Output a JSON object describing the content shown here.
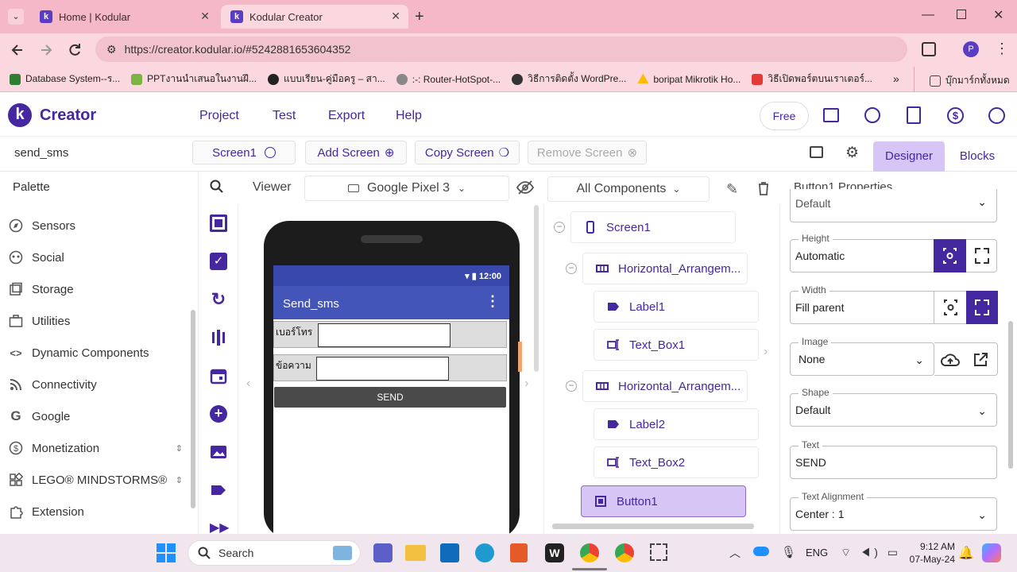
{
  "browser": {
    "tabs": [
      {
        "title": "Home | Kodular",
        "favicon": "kodular-logo"
      },
      {
        "title": "Kodular Creator",
        "favicon": "kodular-logo"
      }
    ],
    "url": "https://creator.kodular.io/#5242881653604352",
    "profile_initial": "P",
    "bookmarks": [
      {
        "label": "Database System--ร...",
        "icon": "3b-icon",
        "color": "#2e7d32"
      },
      {
        "label": "PPTงานนำเสนอในงานฝึ...",
        "icon": "slides-icon",
        "color": "#7cb342"
      },
      {
        "label": "แบบเรียน-คู่มือครู – สา...",
        "icon": "globe-icon",
        "color": "#222222"
      },
      {
        "label": ":-: Router-HotSpot-...",
        "icon": "moon-icon",
        "color": "#555555"
      },
      {
        "label": "วิธีการติดตั้ง WordPre...",
        "icon": "wp-icon",
        "color": "#333333"
      },
      {
        "label": "boripat Mikrotik Ho...",
        "icon": "drive-icon",
        "color": "#fbbc04"
      },
      {
        "label": "วิธีเปิดพอร์ตบนเราเตอร์...",
        "icon": "youtube-icon",
        "color": "#e53935"
      }
    ],
    "bookmarks_folder": "บุ๊กมาร์กทั้งหมด"
  },
  "app": {
    "brand": "Creator",
    "logo_letter": "k",
    "nav": [
      "Project",
      "Test",
      "Export",
      "Help"
    ],
    "plan_badge": "Free",
    "project_name": "send_sms",
    "screen_select": "Screen1",
    "add_screen": "Add Screen",
    "copy_screen": "Copy Screen",
    "remove_screen": "Remove Screen",
    "designer_tab": "Designer",
    "blocks_tab": "Blocks",
    "accent": "#4527a0"
  },
  "palette": {
    "title": "Palette",
    "items": [
      {
        "label": "Sensors",
        "icon": "compass-icon"
      },
      {
        "label": "Social",
        "icon": "social-icon"
      },
      {
        "label": "Storage",
        "icon": "storage-icon"
      },
      {
        "label": "Utilities",
        "icon": "briefcase-icon"
      },
      {
        "label": "Dynamic Components",
        "icon": "code-icon"
      },
      {
        "label": "Connectivity",
        "icon": "rss-icon"
      },
      {
        "label": "Google",
        "icon": "google-icon"
      },
      {
        "label": "Monetization",
        "icon": "dollar-icon"
      },
      {
        "label": "LEGO® MINDSTORMS®",
        "icon": "lego-icon"
      },
      {
        "label": "Extension",
        "icon": "extension-icon"
      }
    ]
  },
  "viewer": {
    "title": "Viewer",
    "device": "Google Pixel 3",
    "phone": {
      "time": "12:00",
      "app_title": "Send_sms",
      "row1_label": "เบอร์โทร",
      "row2_label": "ข้อความ",
      "button_label": "SEND"
    }
  },
  "components": {
    "filter": "All Components",
    "tree": [
      {
        "label": "Screen1",
        "icon": "phone-icon"
      },
      {
        "label": "Horizontal_Arrangem...",
        "icon": "horizontal-icon"
      },
      {
        "label": "Label1",
        "icon": "label-icon"
      },
      {
        "label": "Text_Box1",
        "icon": "textbox-icon"
      },
      {
        "label": "Horizontal_Arrangem...",
        "icon": "horizontal-icon"
      },
      {
        "label": "Label2",
        "icon": "label-icon"
      },
      {
        "label": "Text_Box2",
        "icon": "textbox-icon"
      },
      {
        "label": "Button1",
        "icon": "button-icon",
        "selected": true
      }
    ]
  },
  "properties": {
    "title": "Button1 Properties",
    "fields": [
      {
        "label": "",
        "value": "Default"
      },
      {
        "label": "Height",
        "value": "Automatic"
      },
      {
        "label": "Width",
        "value": "Fill parent"
      },
      {
        "label": "Image",
        "value": "None"
      },
      {
        "label": "Shape",
        "value": "Default"
      },
      {
        "label": "Text",
        "value": "SEND"
      },
      {
        "label": "Text Alignment",
        "value": "Center : 1"
      }
    ]
  },
  "taskbar": {
    "search_placeholder": "Search",
    "language": "ENG",
    "time": "9:12 AM",
    "date": "07-May-24"
  }
}
